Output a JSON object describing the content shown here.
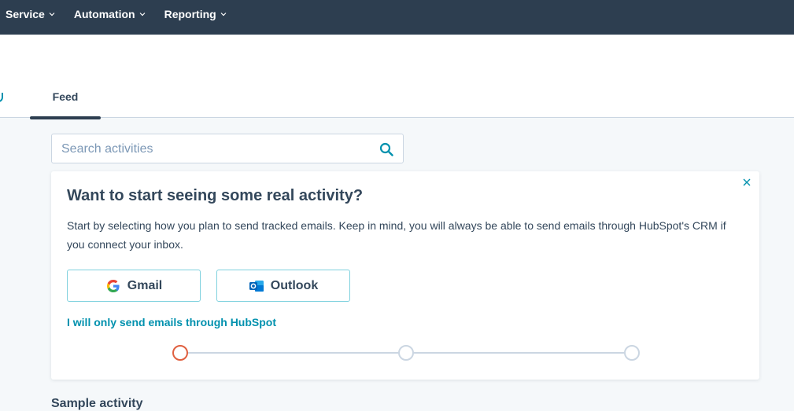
{
  "topnav": {
    "items": [
      {
        "label": "Service"
      },
      {
        "label": "Automation"
      },
      {
        "label": "Reporting"
      }
    ]
  },
  "tabs": {
    "feed_label": "Feed"
  },
  "search": {
    "placeholder": "Search activities",
    "value": ""
  },
  "card": {
    "title": "Want to start seeing some real activity?",
    "description": "Start by selecting how you plan to send tracked emails. Keep in mind, you will always be able to send emails through HubSpot's CRM if you connect your inbox.",
    "gmail_label": "Gmail",
    "outlook_label": "Outlook",
    "hubspot_link": "I will only send emails through HubSpot"
  },
  "sample_heading": "Sample activity",
  "colors": {
    "nav_bg": "#2d3e50",
    "accent": "#0091ae",
    "step_active": "#e06040"
  }
}
